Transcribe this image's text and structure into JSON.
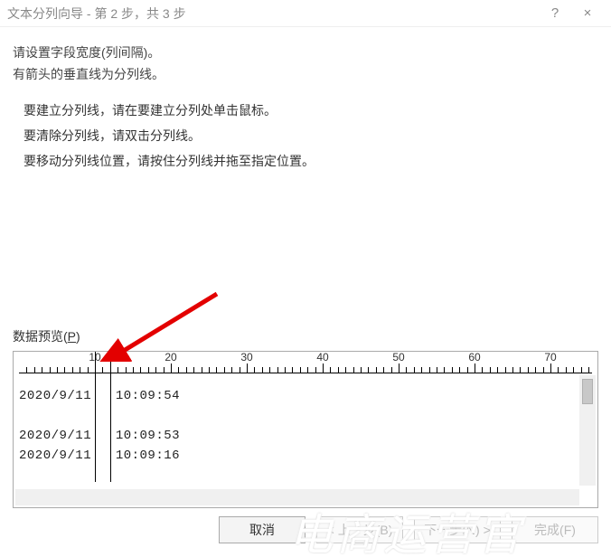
{
  "titlebar": {
    "title": "文本分列向导 - 第 2 步，共 3 步",
    "help": "?",
    "close": "×"
  },
  "intro": {
    "line1": "请设置字段宽度(列间隔)。",
    "line2": "有箭头的垂直线为分列线。"
  },
  "instructions": {
    "line1": "要建立分列线，请在要建立分列处单击鼠标。",
    "line2": "要清除分列线，请双击分列线。",
    "line3": "要移动分列线位置，请按住分列线并拖至指定位置。"
  },
  "preview": {
    "label_prefix": "数据预览(",
    "label_key": "P",
    "label_suffix": ")"
  },
  "ruler": {
    "major_labels": [
      "10",
      "20",
      "30",
      "40",
      "50",
      "60",
      "70"
    ]
  },
  "breaks": {
    "positions": [
      10,
      12
    ]
  },
  "chart_data": {
    "type": "table",
    "title": "数据预览",
    "rows": [
      {
        "col1": "2020/9/11",
        "col2": "10:09:54"
      },
      {
        "col1": "",
        "col2": ""
      },
      {
        "col1": "2020/9/11",
        "col2": "10:09:53"
      },
      {
        "col1": "2020/9/11",
        "col2": "10:09:16"
      }
    ]
  },
  "buttons": {
    "cancel": "取消",
    "back": "< 上一步(B)",
    "next": "下一步(N) >",
    "finish": "完成(F)"
  },
  "watermark": "电商运营官"
}
